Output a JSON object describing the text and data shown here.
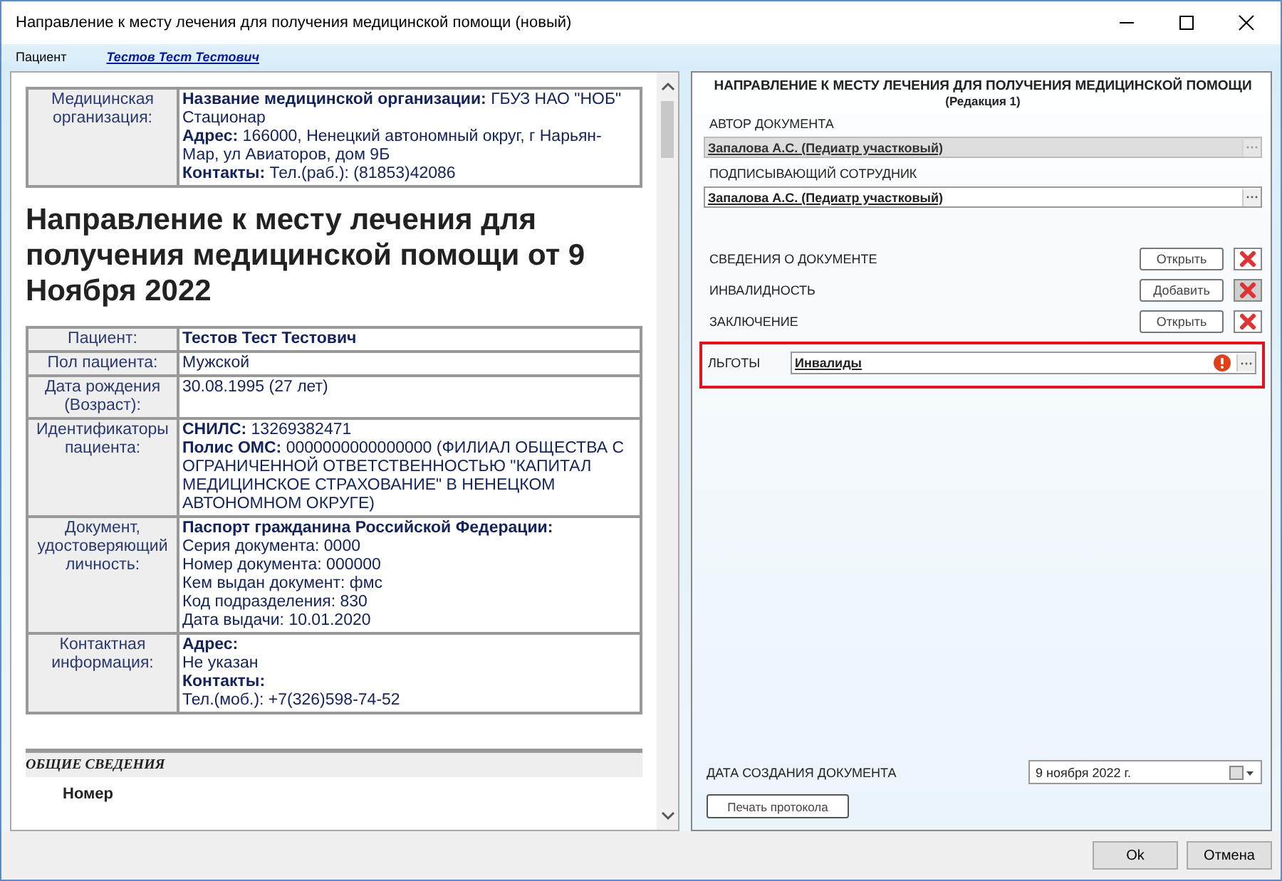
{
  "window": {
    "title": "Направление к месту лечения для получения медицинской помощи (новый)"
  },
  "patient_bar": {
    "label": "Пациент",
    "value": "Тестов Тест Тестович"
  },
  "document": {
    "org_table": [
      {
        "label": "Медицинская организация:",
        "lines": [
          "**Название медицинской организации:** ГБУЗ НАО \"НОБ\" Стационар",
          "**Адрес:** 166000, Ненецкий автономный округ, г Нарьян-Мар, ул Авиаторов, дом 9Б",
          "**Контакты:** Тел.(раб.): (81853)42086"
        ]
      }
    ],
    "heading": "Направление к месту лечения для получения медицинской помощи от 9 Ноября 2022",
    "patient_table": [
      {
        "label": "Пациент:",
        "lines": [
          "**Тестов Тест Тестович**"
        ]
      },
      {
        "label": "Пол пациента:",
        "lines": [
          "Мужской"
        ]
      },
      {
        "label": "Дата рождения (Возраст):",
        "lines": [
          "30.08.1995 (27 лет)"
        ]
      },
      {
        "label": "Идентификаторы пациента:",
        "lines": [
          "**СНИЛС:** 13269382471",
          "**Полис ОМС:** 0000000000000000 (ФИЛИАЛ ОБЩЕСТВА С ОГРАНИЧЕННОЙ ОТВЕТСТВЕННОСТЬЮ \"КАПИТАЛ МЕДИЦИНСКОЕ СТРАХОВАНИЕ\" В НЕНЕЦКОМ АВТОНОМНОМ ОКРУГЕ)"
        ]
      },
      {
        "label": "Документ, удостоверяющий личность:",
        "lines": [
          "**Паспорт гражданина Российской Федерации:**",
          "Серия документа: 0000",
          "Номер документа: 000000",
          "Кем выдан документ: фмс",
          "Код подразделения: 830",
          "Дата выдачи: 10.01.2020"
        ]
      },
      {
        "label": "Контактная информация:",
        "lines": [
          "**Адрес:**",
          "Не указан",
          "**Контакты:**",
          "Тел.(моб.): +7(326)598-74-52"
        ]
      }
    ],
    "section_title": "ОБЩИЕ СВЕДЕНИЯ",
    "section_item": "Номер"
  },
  "form": {
    "title": "НАПРАВЛЕНИЕ К МЕСТУ ЛЕЧЕНИЯ ДЛЯ ПОЛУЧЕНИЯ МЕДИЦИНСКОЙ ПОМОЩИ",
    "subtitle": "(Редакция 1)",
    "fields": [
      {
        "label": "АВТОР ДОКУМЕНТА",
        "value": "Запалова А.С. (Педиатр участковый)",
        "disabled": true
      },
      {
        "label": "ПОДПИСЫВАЮЩИЙ СОТРУДНИК",
        "value": "Запалова А.С. (Педиатр участковый)",
        "disabled": false
      }
    ],
    "sections": [
      {
        "label": "СВЕДЕНИЯ О ДОКУМЕНТЕ",
        "button": "Открыть",
        "delete_disabled": false
      },
      {
        "label": "ИНВАЛИДНОСТЬ",
        "button": "Добавить",
        "delete_disabled": true
      },
      {
        "label": "ЗАКЛЮЧЕНИЕ",
        "button": "Открыть",
        "delete_disabled": false
      }
    ],
    "benefits": {
      "label": "ЛЬГОТЫ",
      "value": "Инвалиды",
      "highlighted": true,
      "error": true
    },
    "date": {
      "label": "ДАТА СОЗДАНИЯ ДОКУМЕНТА",
      "value": "9  ноября   2022 г."
    },
    "print_button": "Печать протокола"
  },
  "footer_buttons": [
    "Ok",
    "Отмена"
  ]
}
